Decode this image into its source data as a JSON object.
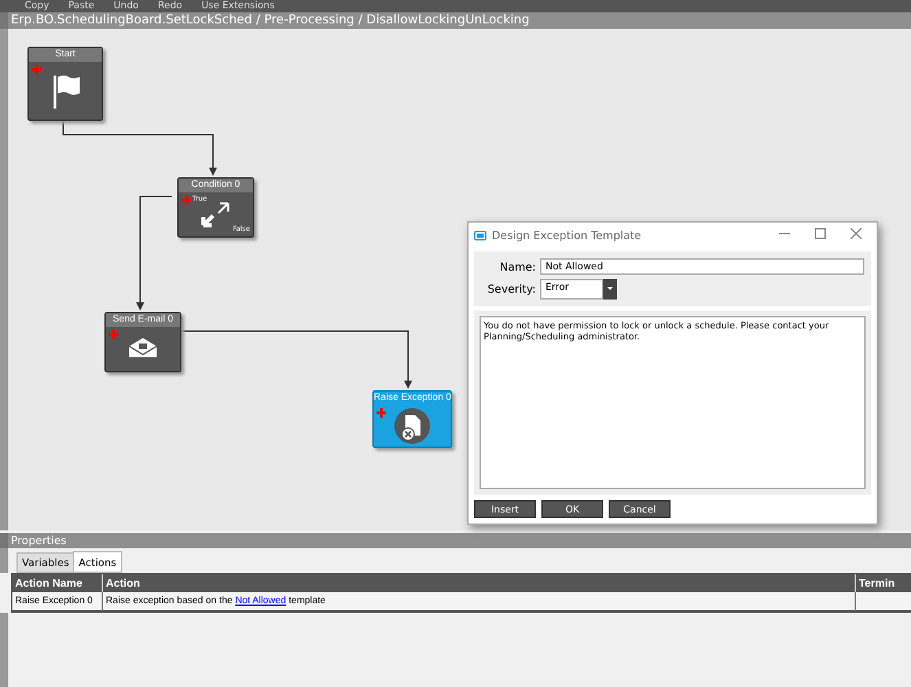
{
  "toolbar": {
    "items": [
      "Copy",
      "Paste",
      "Undo",
      "Redo",
      "Use Extensions"
    ]
  },
  "breadcrumb": "Erp.BO.SchedulingBoard.SetLockSched / Pre-Processing / DisallowLockingUnLocking",
  "canvas": {
    "nodes": [
      {
        "kind": "start",
        "label": "Start",
        "selected": false
      },
      {
        "kind": "condition",
        "label": "Condition 0",
        "selected": false,
        "true_label": "True",
        "false_label": "False"
      },
      {
        "kind": "email",
        "label": "Send E-mail 0",
        "selected": false
      },
      {
        "kind": "exception",
        "label": "Raise Exception 0",
        "selected": true
      }
    ]
  },
  "dialog": {
    "title": "Design Exception Template",
    "name_label": "Name:",
    "name_value": "Not Allowed",
    "severity_label": "Severity:",
    "severity_value": "Error",
    "message": "You do not have permission to lock or unlock a schedule. Please contact your Planning/Scheduling administrator.",
    "buttons": [
      "Insert",
      "OK",
      "Cancel"
    ]
  },
  "properties": {
    "title": "Properties",
    "tabs": [
      {
        "label": "Variables",
        "selected": false
      },
      {
        "label": "Actions",
        "selected": true
      }
    ],
    "table": {
      "columns": [
        "Action Name",
        "Action",
        "Termin"
      ],
      "rows": [
        {
          "action_name": "Raise Exception 0",
          "action_before": "Raise exception based on the",
          "action_link": "Not Allowed",
          "action_after": "template"
        }
      ]
    }
  }
}
